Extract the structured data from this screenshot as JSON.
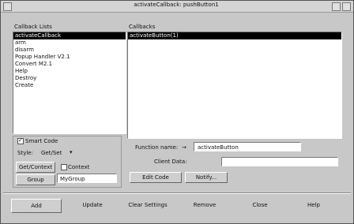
{
  "window": {
    "title": "activateCallback: pushButton1"
  },
  "left_panel": {
    "header": "Callback Lists",
    "items": [
      {
        "label": "activateCallback",
        "selected": true
      },
      {
        "label": "arm",
        "selected": false
      },
      {
        "label": "disarm",
        "selected": false
      },
      {
        "label": "Popup Handler V2.1",
        "selected": false
      },
      {
        "label": "Convert M2.1",
        "selected": false
      },
      {
        "label": "Help",
        "selected": false
      },
      {
        "label": "Destroy",
        "selected": false
      },
      {
        "label": "Create",
        "selected": false
      }
    ]
  },
  "right_panel": {
    "header": "Callbacks",
    "items": [
      {
        "label": "activateButton(1)",
        "selected": true
      }
    ]
  },
  "options": {
    "smart_code_label": "Smart Code",
    "smart_code_checked": true,
    "style_label": "Style:",
    "style_value": "Get/Set",
    "get_context_button": "Get/Context",
    "context_label": "Context",
    "context_checked": false,
    "group_button": "Group",
    "group_value": "MyGroup"
  },
  "function": {
    "name_label": "Function name:",
    "name_value": "activateButton",
    "client_data_label": "Client Data:",
    "client_data_value": "",
    "edit_code_button": "Edit Code",
    "notify_button": "Notify..."
  },
  "bottom": {
    "add": "Add",
    "update": "Update",
    "clear_settings": "Clear Settings",
    "remove": "Remove",
    "close": "Close",
    "help": "Help"
  }
}
